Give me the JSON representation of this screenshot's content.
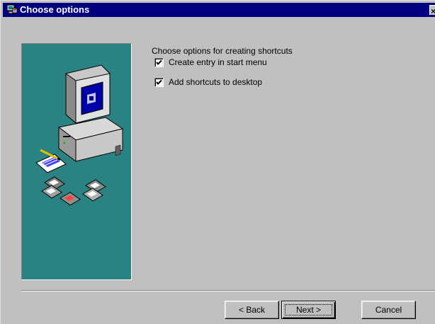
{
  "window": {
    "title": "Choose options",
    "title_icon": "setup-wizard-icon",
    "close_glyph": "×"
  },
  "main": {
    "heading": "Choose options for creating shortcuts",
    "options": [
      {
        "label": "Create entry in start menu",
        "checked": true
      },
      {
        "label": "Add shortcuts to desktop",
        "checked": true
      }
    ]
  },
  "side_panel": {
    "illustration": "computer-with-floppy-disks-illustration",
    "background_color": "#2a8282"
  },
  "buttons": {
    "back_label": "< Back",
    "next_label": "Next >",
    "cancel_label": "Cancel"
  },
  "colors": {
    "titlebar": "#000080",
    "face": "#c0c0c0"
  }
}
